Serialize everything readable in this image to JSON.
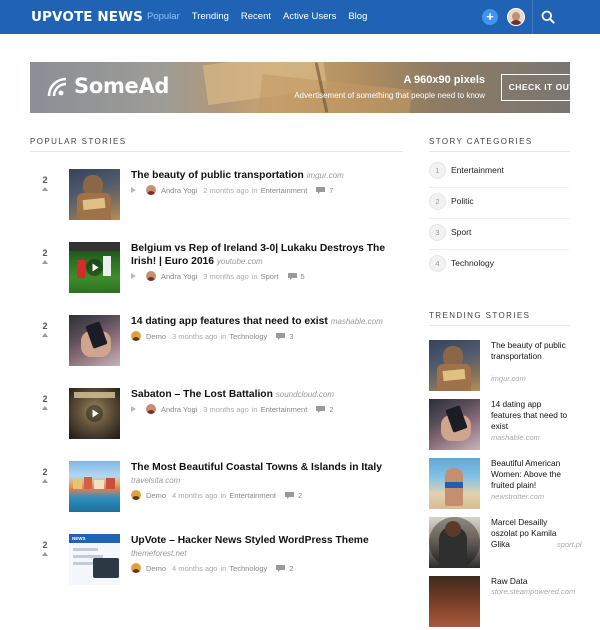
{
  "header": {
    "logo": "UPVOTE NEWS",
    "nav": [
      "Popular",
      "Trending",
      "Recent",
      "Active Users",
      "Blog"
    ],
    "add_label": "+"
  },
  "ad": {
    "brand": "SomeAd",
    "title": "A 960x90 pixels",
    "subtitle": "Advertisement of something that people need to know",
    "button": "CHECK IT OUT!"
  },
  "popular": {
    "heading": "POPULAR STORIES",
    "stories": [
      {
        "votes": "2",
        "title": "The beauty of public transportation",
        "source": "imgur.com",
        "author": "Andra Yogi",
        "time": "2 months ago",
        "in": "in",
        "category": "Entertainment",
        "comments": "7"
      },
      {
        "votes": "2",
        "title": "Belgium vs Rep of Ireland 3-0| Lukaku Destroys The Irish! | Euro 2016",
        "source": "youtube.com",
        "author": "Andra Yogi",
        "time": "3 months ago",
        "in": "in",
        "category": "Sport",
        "comments": "5"
      },
      {
        "votes": "2",
        "title": "14 dating app features that need to exist",
        "source": "mashable.com",
        "author": "Demo",
        "time": "3 months ago",
        "in": "in",
        "category": "Technology",
        "comments": "3"
      },
      {
        "votes": "2",
        "title": "Sabaton – The Lost Battalion",
        "source": "soundcloud.com",
        "author": "Andra Yogi",
        "time": "3 months ago",
        "in": "in",
        "category": "Entertainment",
        "comments": "2"
      },
      {
        "votes": "2",
        "title": "The Most Beautiful Coastal Towns & Islands in Italy",
        "source": "travelsita.com",
        "author": "Demo",
        "time": "4 months ago",
        "in": "in",
        "category": "Entertainment",
        "comments": "2"
      },
      {
        "votes": "2",
        "title": "UpVote – Hacker News Styled WordPress Theme",
        "source": "themeforest.net",
        "author": "Demo",
        "time": "4 months ago",
        "in": "in",
        "category": "Technology",
        "comments": "2"
      }
    ]
  },
  "categories": {
    "heading": "STORY CATEGORIES",
    "items": [
      {
        "num": "1",
        "label": "Entertainment"
      },
      {
        "num": "2",
        "label": "Politic"
      },
      {
        "num": "3",
        "label": "Sport"
      },
      {
        "num": "4",
        "label": "Technology"
      }
    ]
  },
  "trending": {
    "heading": "TRENDING STORIES",
    "items": [
      {
        "title": "The beauty of public transportation",
        "source": "imgur.com"
      },
      {
        "title": "14 dating app features that need to exist",
        "source": "mashable.com"
      },
      {
        "title": "Beautiful American Women: Above the fruited plain!",
        "source": "newstrotter.com"
      },
      {
        "title": "Marcel Desailly oszolat po Kamila Glika",
        "source": "sport.pl"
      },
      {
        "title": "Raw Data",
        "source": "store.steampowered.com"
      }
    ]
  },
  "colors": {
    "header": "#2063b5",
    "nav_active": "#8cc6ff",
    "plus": "#3f95f2"
  },
  "icons": [
    "plus-icon",
    "search-icon",
    "upvote-arrow-icon",
    "play-icon",
    "comment-icon",
    "someads-logo-icon"
  ]
}
